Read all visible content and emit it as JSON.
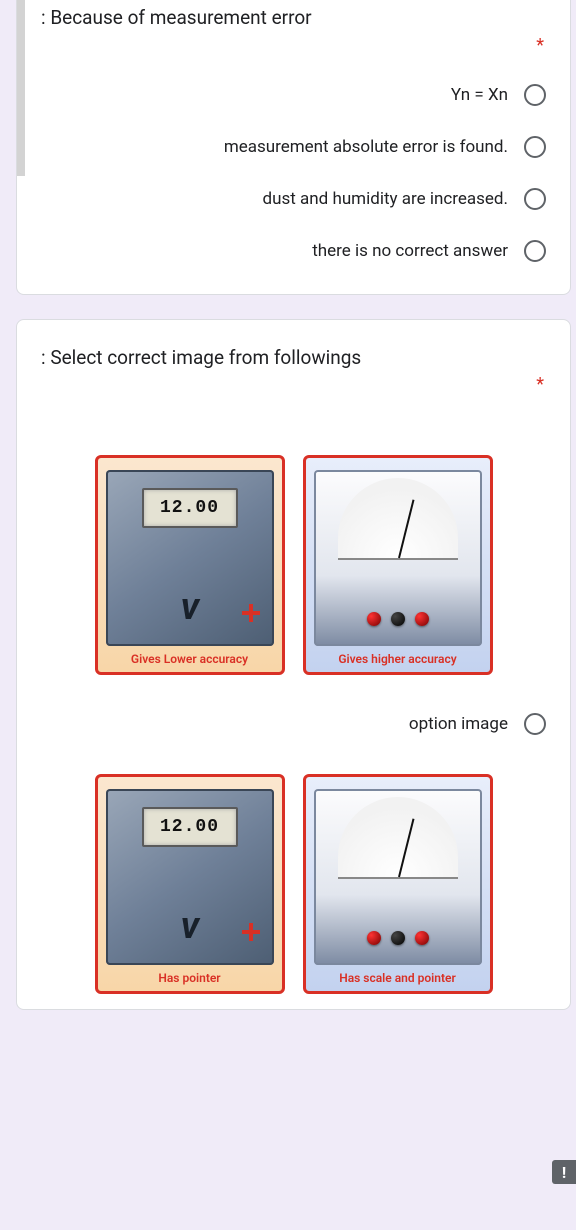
{
  "q1": {
    "title": ": Because of measurement error",
    "required_marker": "*",
    "options": [
      "Yn = Xn",
      "measurement absolute error is found.",
      "dust and humidity are increased.",
      "there is no correct answer"
    ]
  },
  "q2": {
    "title": ": Select correct image from followings",
    "required_marker": "*",
    "image_options": [
      {
        "left_caption": "Gives Lower accuracy",
        "right_caption": "Gives higher accuracy",
        "lcd_value": "12.00",
        "label": "option image"
      },
      {
        "left_caption": "Has pointer",
        "right_caption": "Has scale and pointer",
        "lcd_value": "12.00",
        "label": ""
      }
    ]
  },
  "alert_icon_glyph": "!"
}
